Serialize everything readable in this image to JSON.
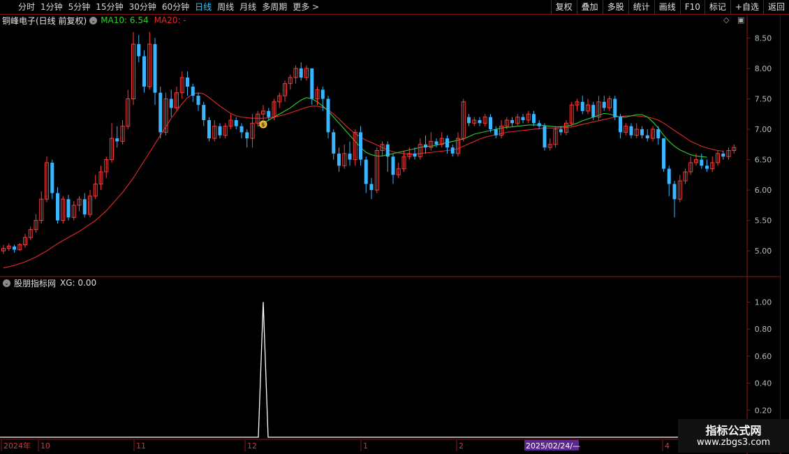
{
  "toolbar": {
    "periods": [
      "分时",
      "1分钟",
      "5分钟",
      "15分钟",
      "30分钟",
      "60分钟",
      "日线",
      "周线",
      "月线",
      "多周期",
      "更多 >"
    ],
    "active_period": "日线",
    "tools": [
      "复权",
      "叠加",
      "多股",
      "统计",
      "画线",
      "F10",
      "标记",
      "+自选",
      "返回"
    ]
  },
  "main_header": {
    "stock": "铜峰电子(日线 前复权)",
    "ma10": "MA10: 6.54",
    "ma20": "MA20: -"
  },
  "sub_header": {
    "indicator": "股朋指标网",
    "xg": "XG: 0.00"
  },
  "colors": {
    "up": "#ff3b3b",
    "down": "#39b6ff",
    "ma10": "#2ed12e",
    "ma20": "#e52a2a",
    "axis": "#8a1a1a",
    "indicator_line": "#ffffff",
    "active_tab": "#35c9ff"
  },
  "axis": {
    "price_ticks": [
      "8.50",
      "8.00",
      "7.50",
      "7.00",
      "6.50",
      "6.00",
      "5.50",
      "5.00"
    ],
    "price_values": [
      8.5,
      8.0,
      7.5,
      7.0,
      6.5,
      6.0,
      5.5,
      5.0
    ],
    "indicator_ticks": [
      "1.00",
      "0.80",
      "0.60",
      "0.40",
      "0.20"
    ],
    "indicator_values": [
      1.0,
      0.8,
      0.6,
      0.4,
      0.2
    ],
    "date_labels": [
      "2024年",
      "10",
      "11",
      "12",
      "1",
      "2",
      "4"
    ],
    "cursor_date": "2025/02/24/—"
  },
  "chart_data": {
    "type": "candlestick",
    "price_range": [
      4.6,
      8.7
    ],
    "candles": [
      [
        5.0,
        5.04,
        4.95,
        5.1
      ],
      [
        5.04,
        5.08,
        5.0,
        5.12
      ],
      [
        5.07,
        5.02,
        4.97,
        5.1
      ],
      [
        5.02,
        5.1,
        5.0,
        5.13
      ],
      [
        5.1,
        5.22,
        5.05,
        5.28
      ],
      [
        5.22,
        5.35,
        5.18,
        5.4
      ],
      [
        5.35,
        5.5,
        5.3,
        5.6
      ],
      [
        5.5,
        5.85,
        5.45,
        5.98
      ],
      [
        5.85,
        6.45,
        5.8,
        6.55
      ],
      [
        6.45,
        5.95,
        5.85,
        6.5
      ],
      [
        5.95,
        5.5,
        5.45,
        6.05
      ],
      [
        5.5,
        5.85,
        5.45,
        5.9
      ],
      [
        5.85,
        5.55,
        5.5,
        5.92
      ],
      [
        5.55,
        5.75,
        5.5,
        5.82
      ],
      [
        5.75,
        5.85,
        5.65,
        5.9
      ],
      [
        5.85,
        5.6,
        5.55,
        5.95
      ],
      [
        5.6,
        5.9,
        5.55,
        6.0
      ],
      [
        5.9,
        6.1,
        5.85,
        6.25
      ],
      [
        6.1,
        6.3,
        6.0,
        6.4
      ],
      [
        6.3,
        6.5,
        6.2,
        6.55
      ],
      [
        6.5,
        6.85,
        6.45,
        7.1
      ],
      [
        6.85,
        6.8,
        6.7,
        7.05
      ],
      [
        6.8,
        7.05,
        6.75,
        7.15
      ],
      [
        7.05,
        7.5,
        7.0,
        7.65
      ],
      [
        7.5,
        8.4,
        7.4,
        8.6
      ],
      [
        8.4,
        8.2,
        8.1,
        8.55
      ],
      [
        8.2,
        7.7,
        7.6,
        8.3
      ],
      [
        7.7,
        8.4,
        7.65,
        8.6
      ],
      [
        8.4,
        7.6,
        7.4,
        8.5
      ],
      [
        7.6,
        6.95,
        6.85,
        7.7
      ],
      [
        6.95,
        7.5,
        6.9,
        7.6
      ],
      [
        7.5,
        7.35,
        7.2,
        7.65
      ],
      [
        7.35,
        7.6,
        7.3,
        7.7
      ],
      [
        7.6,
        7.85,
        7.5,
        7.95
      ],
      [
        7.85,
        7.7,
        7.55,
        7.95
      ],
      [
        7.7,
        7.55,
        7.45,
        7.75
      ],
      [
        7.55,
        7.4,
        7.3,
        7.6
      ],
      [
        7.4,
        7.15,
        7.05,
        7.45
      ],
      [
        7.15,
        6.85,
        6.8,
        7.2
      ],
      [
        6.85,
        7.05,
        6.8,
        7.15
      ],
      [
        7.05,
        6.9,
        6.85,
        7.1
      ],
      [
        6.9,
        7.05,
        6.85,
        7.1
      ],
      [
        7.05,
        7.15,
        7.0,
        7.25
      ],
      [
        7.15,
        7.05,
        7.0,
        7.2
      ],
      [
        7.05,
        6.95,
        6.85,
        7.1
      ],
      [
        6.95,
        6.85,
        6.7,
        7.0
      ],
      [
        6.85,
        7.1,
        6.7,
        7.25
      ],
      [
        7.1,
        7.25,
        7.05,
        7.3
      ],
      [
        7.25,
        7.3,
        7.15,
        7.4
      ],
      [
        7.3,
        7.2,
        7.15,
        7.35
      ],
      [
        7.2,
        7.45,
        7.15,
        7.5
      ],
      [
        7.45,
        7.55,
        7.35,
        7.6
      ],
      [
        7.55,
        7.75,
        7.45,
        7.8
      ],
      [
        7.75,
        7.85,
        7.65,
        7.9
      ],
      [
        7.85,
        8.0,
        7.75,
        8.05
      ],
      [
        8.0,
        7.85,
        7.8,
        8.1
      ],
      [
        7.85,
        8.0,
        7.8,
        8.05
      ],
      [
        8.0,
        7.5,
        7.4,
        8.0
      ],
      [
        7.5,
        7.65,
        7.4,
        7.7
      ],
      [
        7.65,
        7.5,
        7.3,
        7.7
      ],
      [
        7.5,
        6.95,
        6.85,
        7.55
      ],
      [
        6.95,
        6.6,
        6.5,
        7.0
      ],
      [
        6.6,
        6.4,
        6.3,
        6.7
      ],
      [
        6.4,
        6.6,
        6.35,
        6.75
      ],
      [
        6.6,
        6.5,
        6.4,
        6.8
      ],
      [
        6.5,
        6.95,
        6.4,
        7.0
      ],
      [
        6.95,
        6.5,
        6.4,
        7.05
      ],
      [
        6.5,
        6.1,
        5.95,
        6.55
      ],
      [
        6.1,
        6.0,
        5.85,
        6.2
      ],
      [
        6.0,
        6.65,
        5.95,
        6.7
      ],
      [
        6.65,
        6.75,
        6.55,
        6.8
      ],
      [
        6.75,
        6.55,
        6.3,
        6.8
      ],
      [
        6.55,
        6.25,
        6.1,
        6.6
      ],
      [
        6.25,
        6.35,
        6.2,
        6.45
      ],
      [
        6.35,
        6.55,
        6.3,
        6.65
      ],
      [
        6.55,
        6.6,
        6.5,
        6.7
      ],
      [
        6.6,
        6.55,
        6.5,
        6.7
      ],
      [
        6.55,
        6.75,
        6.5,
        6.85
      ],
      [
        6.75,
        6.7,
        6.6,
        6.9
      ],
      [
        6.7,
        6.8,
        6.65,
        6.95
      ],
      [
        6.8,
        6.75,
        6.7,
        6.85
      ],
      [
        6.75,
        6.85,
        6.7,
        6.95
      ],
      [
        6.85,
        6.7,
        6.6,
        6.9
      ],
      [
        6.7,
        6.6,
        6.55,
        6.75
      ],
      [
        6.6,
        6.85,
        6.55,
        6.95
      ],
      [
        6.85,
        7.45,
        6.8,
        7.5
      ],
      [
        7.2,
        7.1,
        7.05,
        7.25
      ],
      [
        7.1,
        7.15,
        7.05,
        7.2
      ],
      [
        7.15,
        7.1,
        7.05,
        7.2
      ],
      [
        7.1,
        7.2,
        7.05,
        7.25
      ],
      [
        7.2,
        7.0,
        6.95,
        7.25
      ],
      [
        7.0,
        6.9,
        6.85,
        7.05
      ],
      [
        6.9,
        7.05,
        6.85,
        7.15
      ],
      [
        7.05,
        7.15,
        7.0,
        7.2
      ],
      [
        7.15,
        7.1,
        7.05,
        7.2
      ],
      [
        7.1,
        7.2,
        7.05,
        7.25
      ],
      [
        7.2,
        7.15,
        7.1,
        7.25
      ],
      [
        7.15,
        7.25,
        7.1,
        7.3
      ],
      [
        7.25,
        7.1,
        7.05,
        7.3
      ],
      [
        7.1,
        7.05,
        7.0,
        7.15
      ],
      [
        7.05,
        6.7,
        6.65,
        7.1
      ],
      [
        6.7,
        6.75,
        6.65,
        6.85
      ],
      [
        6.75,
        7.0,
        6.7,
        7.05
      ],
      [
        7.0,
        6.95,
        6.9,
        7.05
      ],
      [
        6.95,
        7.1,
        6.9,
        7.15
      ],
      [
        7.1,
        7.4,
        7.05,
        7.45
      ],
      [
        7.4,
        7.45,
        7.3,
        7.5
      ],
      [
        7.45,
        7.3,
        7.25,
        7.55
      ],
      [
        7.3,
        7.4,
        7.25,
        7.5
      ],
      [
        7.4,
        7.2,
        7.15,
        7.45
      ],
      [
        7.2,
        7.45,
        7.15,
        7.55
      ],
      [
        7.45,
        7.35,
        7.3,
        7.55
      ],
      [
        7.35,
        7.5,
        7.3,
        7.55
      ],
      [
        7.5,
        7.2,
        7.15,
        7.55
      ],
      [
        7.2,
        6.95,
        6.85,
        7.25
      ],
      [
        6.95,
        7.05,
        6.9,
        7.1
      ],
      [
        7.05,
        6.9,
        6.85,
        7.1
      ],
      [
        6.9,
        7.0,
        6.85,
        7.1
      ],
      [
        7.0,
        6.9,
        6.85,
        7.05
      ],
      [
        6.9,
        6.85,
        6.8,
        7.0
      ],
      [
        6.85,
        7.0,
        6.8,
        7.05
      ],
      [
        7.0,
        6.85,
        6.75,
        7.05
      ],
      [
        6.85,
        6.35,
        6.3,
        6.85
      ],
      [
        6.35,
        6.1,
        5.9,
        6.4
      ],
      [
        6.1,
        5.85,
        5.55,
        6.15
      ],
      [
        5.85,
        6.15,
        5.8,
        6.25
      ],
      [
        6.15,
        6.3,
        6.1,
        6.35
      ],
      [
        6.3,
        6.45,
        6.25,
        6.55
      ],
      [
        6.45,
        6.5,
        6.4,
        6.6
      ],
      [
        6.5,
        6.4,
        6.35,
        6.6
      ],
      [
        6.4,
        6.35,
        6.3,
        6.5
      ],
      [
        6.35,
        6.45,
        6.3,
        6.55
      ],
      [
        6.45,
        6.6,
        6.4,
        6.65
      ],
      [
        6.6,
        6.55,
        6.5,
        6.65
      ],
      [
        6.55,
        6.65,
        6.5,
        6.7
      ],
      [
        6.65,
        6.7,
        6.6,
        6.75
      ]
    ],
    "ma10": [
      null,
      null,
      null,
      null,
      null,
      null,
      null,
      null,
      null,
      null,
      null,
      null,
      null,
      null,
      null,
      null,
      null,
      null,
      null,
      null,
      null,
      null,
      null,
      null,
      null,
      null,
      null,
      null,
      null,
      null,
      null,
      null,
      null,
      null,
      null,
      null,
      null,
      null,
      null,
      null,
      null,
      null,
      null,
      null,
      null,
      null,
      null,
      7.05,
      7.1,
      7.15,
      7.2,
      7.25,
      7.3,
      7.35,
      7.42,
      7.48,
      7.52,
      7.5,
      7.45,
      7.38,
      7.3,
      7.2,
      7.1,
      7.0,
      6.9,
      6.8,
      6.7,
      6.62,
      6.58,
      6.56,
      6.56,
      6.58,
      6.6,
      6.62,
      6.64,
      6.66,
      6.68,
      6.7,
      6.72,
      6.72,
      6.74,
      6.76,
      6.78,
      6.8,
      6.82,
      6.84,
      6.88,
      6.92,
      6.94,
      6.96,
      6.98,
      7.0,
      7.02,
      7.03,
      7.04,
      7.05,
      7.06,
      7.07,
      7.07,
      7.07,
      7.06,
      7.05,
      7.04,
      7.04,
      7.05,
      7.07,
      7.1,
      7.14,
      7.17,
      7.2,
      7.23,
      7.26,
      7.25,
      7.22,
      7.2,
      7.2,
      7.22,
      7.24,
      7.24,
      7.2,
      7.12,
      7.02,
      6.9,
      6.8,
      6.72,
      6.66,
      6.62,
      6.58,
      6.56,
      6.55,
      6.54
    ],
    "ma20": [
      4.72,
      4.74,
      4.76,
      4.79,
      4.82,
      4.86,
      4.9,
      4.95,
      5.0,
      5.06,
      5.12,
      5.17,
      5.22,
      5.27,
      5.32,
      5.38,
      5.44,
      5.5,
      5.58,
      5.66,
      5.76,
      5.86,
      5.96,
      6.08,
      6.2,
      6.34,
      6.48,
      6.62,
      6.76,
      6.9,
      7.04,
      7.18,
      7.3,
      7.42,
      7.52,
      7.58,
      7.6,
      7.58,
      7.52,
      7.45,
      7.38,
      7.32,
      7.26,
      7.22,
      7.2,
      7.19,
      7.18,
      7.18,
      7.18,
      7.19,
      7.2,
      7.22,
      7.24,
      7.27,
      7.3,
      7.33,
      7.36,
      7.38,
      7.38,
      7.36,
      7.32,
      7.25,
      7.17,
      7.08,
      7.0,
      6.93,
      6.87,
      6.82,
      6.78,
      6.74,
      6.7,
      6.66,
      6.63,
      6.61,
      6.6,
      6.59,
      6.59,
      6.6,
      6.61,
      6.62,
      6.63,
      6.64,
      6.65,
      6.66,
      6.68,
      6.72,
      6.76,
      6.8,
      6.84,
      6.87,
      6.89,
      6.91,
      6.93,
      6.95,
      6.96,
      6.97,
      6.98,
      6.99,
      7.0,
      7.01,
      7.02,
      7.02,
      7.02,
      7.02,
      7.03,
      7.04,
      7.06,
      7.08,
      7.1,
      7.12,
      7.14,
      7.16,
      7.18,
      7.2,
      7.21,
      7.22,
      7.22,
      7.22,
      7.21,
      7.2,
      7.18,
      7.15,
      7.1,
      7.04,
      6.98,
      6.92,
      6.86,
      6.8,
      6.76,
      6.72,
      6.69,
      6.67,
      6.65,
      6.64
    ],
    "signal_xg": {
      "index": 48,
      "value": 1.0
    },
    "marker_index": 48,
    "indicator_range": [
      0,
      1.1
    ]
  }
}
